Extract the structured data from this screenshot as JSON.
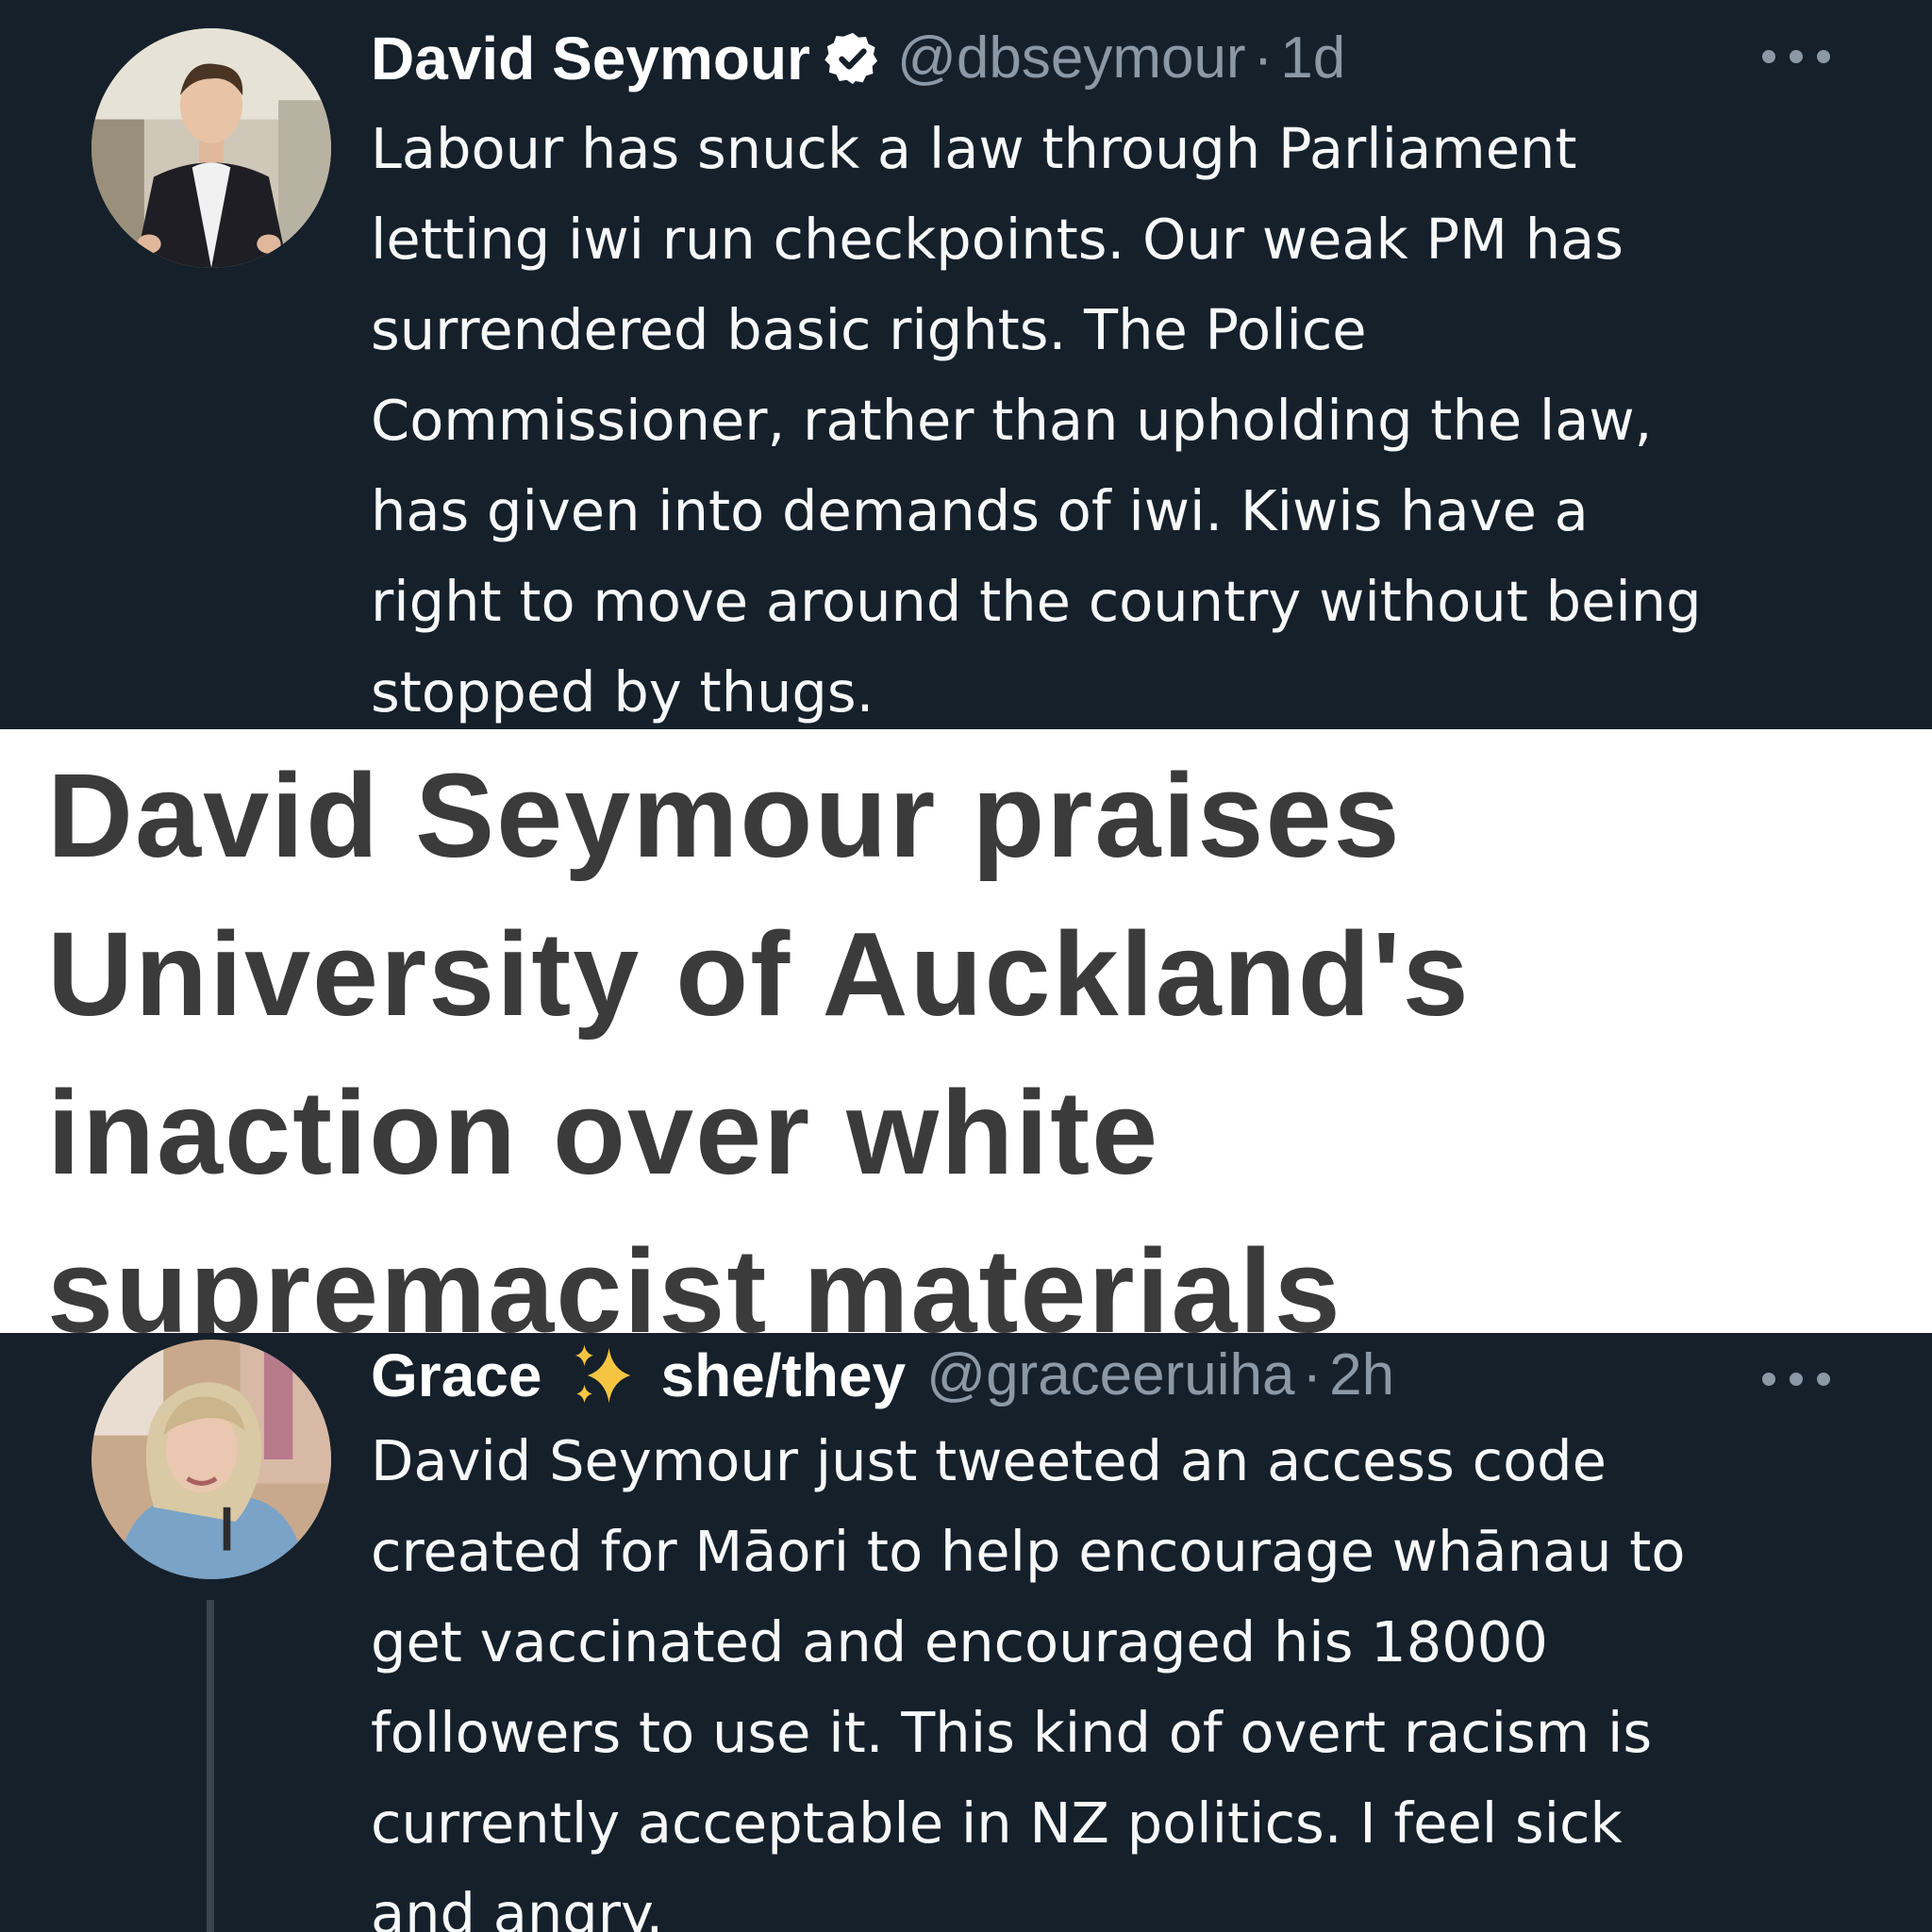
{
  "tweet1": {
    "name": "David Seymour",
    "handle": "@dbseymour",
    "separator": "·",
    "time": "1d",
    "verified_icon": "verified-badge-icon",
    "body_lines": [
      "Labour has snuck a law through Parliament",
      "letting iwi run checkpoints. Our weak PM has",
      "surrendered basic rights. The Police",
      "Commissioner, rather than upholding the law,",
      "has given into demands of iwi. Kiwis have a",
      "right to move around the country without being",
      "stopped by thugs."
    ]
  },
  "headline": {
    "lines": [
      "David Seymour praises",
      "University of Auckland's",
      "inaction over white",
      "supremacist materials"
    ]
  },
  "tweet2": {
    "name": "Grace",
    "sparkle_icon": "sparkles-emoji-icon",
    "pronouns": "she/they",
    "handle": "@graceeruiha",
    "separator": "·",
    "time": "2h",
    "body_lines": [
      "David Seymour just tweeted an access code",
      "created for Māori to help encourage whānau to",
      "get vaccinated and encouraged his 18000",
      "followers to use it. This kind of overt racism is",
      "currently acceptable in NZ politics. I feel sick",
      "and angry."
    ]
  },
  "colors": {
    "background": "#15202b",
    "text": "#f7f9f9",
    "muted": "#8b98a5",
    "headline_text": "#3b3b3b",
    "headline_bg": "#ffffff"
  }
}
